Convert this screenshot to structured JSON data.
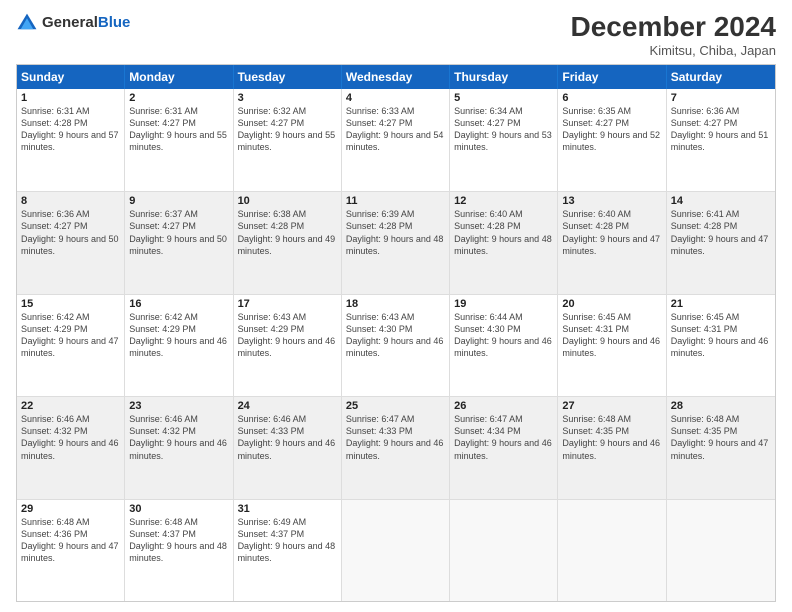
{
  "header": {
    "logo_general": "General",
    "logo_blue": "Blue",
    "title": "December 2024",
    "subtitle": "Kimitsu, Chiba, Japan"
  },
  "days_of_week": [
    "Sunday",
    "Monday",
    "Tuesday",
    "Wednesday",
    "Thursday",
    "Friday",
    "Saturday"
  ],
  "weeks": [
    [
      {
        "day": "1",
        "text": "Sunrise: 6:31 AM\nSunset: 4:28 PM\nDaylight: 9 hours and 57 minutes.",
        "shaded": false
      },
      {
        "day": "2",
        "text": "Sunrise: 6:31 AM\nSunset: 4:27 PM\nDaylight: 9 hours and 55 minutes.",
        "shaded": false
      },
      {
        "day": "3",
        "text": "Sunrise: 6:32 AM\nSunset: 4:27 PM\nDaylight: 9 hours and 55 minutes.",
        "shaded": false
      },
      {
        "day": "4",
        "text": "Sunrise: 6:33 AM\nSunset: 4:27 PM\nDaylight: 9 hours and 54 minutes.",
        "shaded": false
      },
      {
        "day": "5",
        "text": "Sunrise: 6:34 AM\nSunset: 4:27 PM\nDaylight: 9 hours and 53 minutes.",
        "shaded": false
      },
      {
        "day": "6",
        "text": "Sunrise: 6:35 AM\nSunset: 4:27 PM\nDaylight: 9 hours and 52 minutes.",
        "shaded": false
      },
      {
        "day": "7",
        "text": "Sunrise: 6:36 AM\nSunset: 4:27 PM\nDaylight: 9 hours and 51 minutes.",
        "shaded": false
      }
    ],
    [
      {
        "day": "8",
        "text": "Sunrise: 6:36 AM\nSunset: 4:27 PM\nDaylight: 9 hours and 50 minutes.",
        "shaded": true
      },
      {
        "day": "9",
        "text": "Sunrise: 6:37 AM\nSunset: 4:27 PM\nDaylight: 9 hours and 50 minutes.",
        "shaded": true
      },
      {
        "day": "10",
        "text": "Sunrise: 6:38 AM\nSunset: 4:28 PM\nDaylight: 9 hours and 49 minutes.",
        "shaded": true
      },
      {
        "day": "11",
        "text": "Sunrise: 6:39 AM\nSunset: 4:28 PM\nDaylight: 9 hours and 48 minutes.",
        "shaded": true
      },
      {
        "day": "12",
        "text": "Sunrise: 6:40 AM\nSunset: 4:28 PM\nDaylight: 9 hours and 48 minutes.",
        "shaded": true
      },
      {
        "day": "13",
        "text": "Sunrise: 6:40 AM\nSunset: 4:28 PM\nDaylight: 9 hours and 47 minutes.",
        "shaded": true
      },
      {
        "day": "14",
        "text": "Sunrise: 6:41 AM\nSunset: 4:28 PM\nDaylight: 9 hours and 47 minutes.",
        "shaded": true
      }
    ],
    [
      {
        "day": "15",
        "text": "Sunrise: 6:42 AM\nSunset: 4:29 PM\nDaylight: 9 hours and 47 minutes.",
        "shaded": false
      },
      {
        "day": "16",
        "text": "Sunrise: 6:42 AM\nSunset: 4:29 PM\nDaylight: 9 hours and 46 minutes.",
        "shaded": false
      },
      {
        "day": "17",
        "text": "Sunrise: 6:43 AM\nSunset: 4:29 PM\nDaylight: 9 hours and 46 minutes.",
        "shaded": false
      },
      {
        "day": "18",
        "text": "Sunrise: 6:43 AM\nSunset: 4:30 PM\nDaylight: 9 hours and 46 minutes.",
        "shaded": false
      },
      {
        "day": "19",
        "text": "Sunrise: 6:44 AM\nSunset: 4:30 PM\nDaylight: 9 hours and 46 minutes.",
        "shaded": false
      },
      {
        "day": "20",
        "text": "Sunrise: 6:45 AM\nSunset: 4:31 PM\nDaylight: 9 hours and 46 minutes.",
        "shaded": false
      },
      {
        "day": "21",
        "text": "Sunrise: 6:45 AM\nSunset: 4:31 PM\nDaylight: 9 hours and 46 minutes.",
        "shaded": false
      }
    ],
    [
      {
        "day": "22",
        "text": "Sunrise: 6:46 AM\nSunset: 4:32 PM\nDaylight: 9 hours and 46 minutes.",
        "shaded": true
      },
      {
        "day": "23",
        "text": "Sunrise: 6:46 AM\nSunset: 4:32 PM\nDaylight: 9 hours and 46 minutes.",
        "shaded": true
      },
      {
        "day": "24",
        "text": "Sunrise: 6:46 AM\nSunset: 4:33 PM\nDaylight: 9 hours and 46 minutes.",
        "shaded": true
      },
      {
        "day": "25",
        "text": "Sunrise: 6:47 AM\nSunset: 4:33 PM\nDaylight: 9 hours and 46 minutes.",
        "shaded": true
      },
      {
        "day": "26",
        "text": "Sunrise: 6:47 AM\nSunset: 4:34 PM\nDaylight: 9 hours and 46 minutes.",
        "shaded": true
      },
      {
        "day": "27",
        "text": "Sunrise: 6:48 AM\nSunset: 4:35 PM\nDaylight: 9 hours and 46 minutes.",
        "shaded": true
      },
      {
        "day": "28",
        "text": "Sunrise: 6:48 AM\nSunset: 4:35 PM\nDaylight: 9 hours and 47 minutes.",
        "shaded": true
      }
    ],
    [
      {
        "day": "29",
        "text": "Sunrise: 6:48 AM\nSunset: 4:36 PM\nDaylight: 9 hours and 47 minutes.",
        "shaded": false
      },
      {
        "day": "30",
        "text": "Sunrise: 6:48 AM\nSunset: 4:37 PM\nDaylight: 9 hours and 48 minutes.",
        "shaded": false
      },
      {
        "day": "31",
        "text": "Sunrise: 6:49 AM\nSunset: 4:37 PM\nDaylight: 9 hours and 48 minutes.",
        "shaded": false
      },
      {
        "day": "",
        "text": "",
        "shaded": false,
        "empty": true
      },
      {
        "day": "",
        "text": "",
        "shaded": false,
        "empty": true
      },
      {
        "day": "",
        "text": "",
        "shaded": false,
        "empty": true
      },
      {
        "day": "",
        "text": "",
        "shaded": false,
        "empty": true
      }
    ]
  ]
}
